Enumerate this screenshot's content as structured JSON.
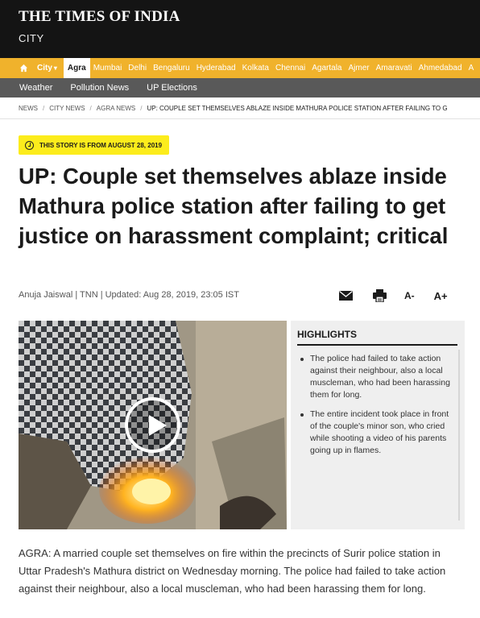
{
  "masthead": {
    "logo": "THE TIMES OF INDIA",
    "section": "CITY"
  },
  "city_nav": {
    "city_label": "City",
    "items": [
      {
        "label": "Agra",
        "active": true
      },
      {
        "label": "Mumbai"
      },
      {
        "label": "Delhi"
      },
      {
        "label": "Bengaluru"
      },
      {
        "label": "Hyderabad"
      },
      {
        "label": "Kolkata"
      },
      {
        "label": "Chennai"
      },
      {
        "label": "Agartala"
      },
      {
        "label": "Ajmer"
      },
      {
        "label": "Amaravati"
      },
      {
        "label": "Ahmedabad"
      },
      {
        "label": "A"
      }
    ]
  },
  "sub_nav": {
    "items": [
      "Weather",
      "Pollution News",
      "UP Elections"
    ]
  },
  "breadcrumb": [
    "NEWS",
    "CITY NEWS",
    "AGRA NEWS",
    "UP: COUPLE SET THEMSELVES ABLAZE INSIDE MATHURA POLICE STATION AFTER FAILING TO G"
  ],
  "article": {
    "story_date": "THIS STORY IS FROM AUGUST 28, 2019",
    "headline": "UP: Couple set themselves ablaze inside Mathura police station after failing to get justice on harassment complaint; critical",
    "byline": "Anuja Jaiswal | TNN | Updated: Aug 28, 2019, 23:05 IST",
    "tools": {
      "font_decrease": "A-",
      "font_increase": "A+"
    },
    "highlights": {
      "title": "HIGHLIGHTS",
      "items": [
        "The police had failed to take action against their neighbour, also a local muscleman, who had been harassing them for long.",
        "The entire incident took place in front of the couple's minor son, who cried while shooting a video of his parents going up in flames."
      ]
    },
    "body": "AGRA: A married couple set themselves on fire within the precincts of Surir police station in Uttar Pradesh's Mathura district on Wednesday morning. The police had failed to take action against their neighbour, also a local muscleman, who had been harassing them for long."
  },
  "colors": {
    "masthead": "#141414",
    "city_nav": "#f0b22c",
    "sub_nav": "#595959",
    "date_badge": "#fcec1c",
    "highlights_bg": "#efefef"
  }
}
